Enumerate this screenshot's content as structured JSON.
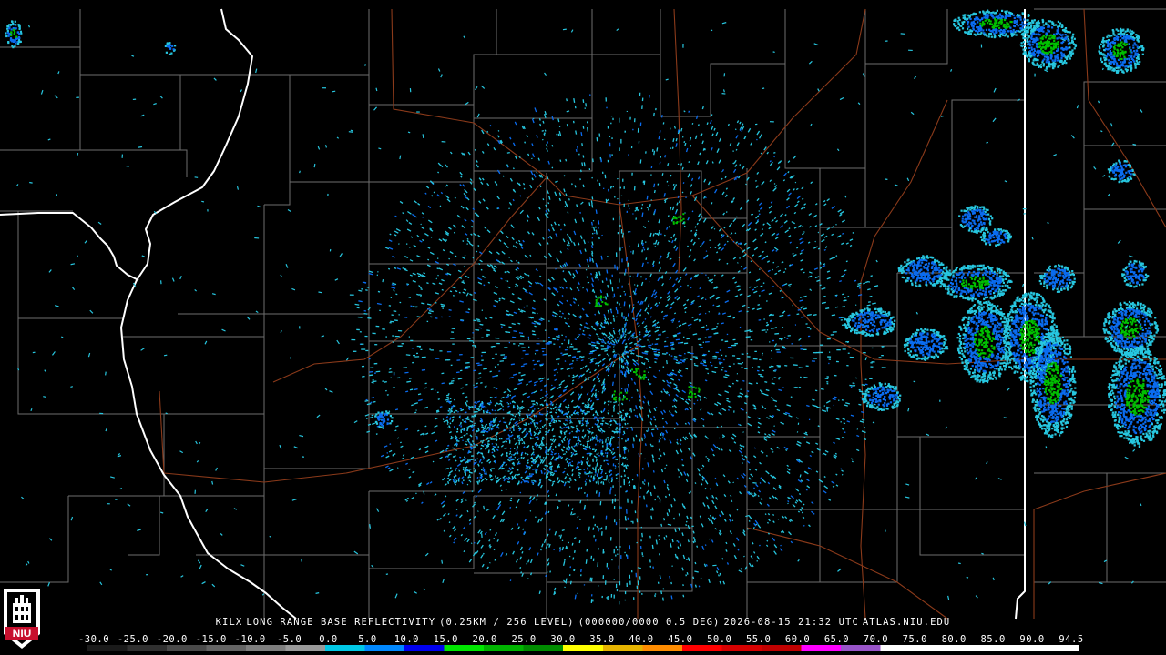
{
  "product": {
    "site": "KILX",
    "name": "LONG RANGE BASE REFLECTIVITY",
    "resolution": "(0.25KM / 256 LEVEL)",
    "volume": "(000000/0000 0.5 DEG)",
    "datetime": "2026-08-15 21:32 UTC",
    "source": "ATLAS.NIU.EDU"
  },
  "logo": {
    "text": "NIU",
    "color": "#c8102e"
  },
  "scale": {
    "labels": [
      "-30.0",
      "-25.0",
      "-20.0",
      "-15.0",
      "-10.0",
      "-5.0",
      "0.0",
      "5.0",
      "10.0",
      "15.0",
      "20.0",
      "25.0",
      "30.0",
      "35.0",
      "40.0",
      "45.0",
      "50.0",
      "55.0",
      "60.0",
      "65.0",
      "70.0",
      "75.0",
      "80.0",
      "85.0",
      "90.0",
      "94.5"
    ],
    "colors": [
      "#1a1a1a",
      "#303030",
      "#4a4a4a",
      "#646464",
      "#7e7e7e",
      "#9a9a9a",
      "#00c8e6",
      "#0088ff",
      "#0000f0",
      "#00e600",
      "#00b400",
      "#008c00",
      "#ffff00",
      "#e6b400",
      "#ff8c00",
      "#ff0000",
      "#d60000",
      "#c00000",
      "#ff00ff",
      "#9955c9",
      "#ffffff",
      "#ffffff",
      "#ffffff",
      "#ffffff",
      "#ffffff"
    ]
  },
  "colors": {
    "county": "#6e6e6e",
    "state": "#ffffff",
    "road": "#8b3a1a",
    "echo_light": "#27c7e0",
    "echo_mid": "#0a6cf0",
    "echo_strong": "#00c000"
  }
}
